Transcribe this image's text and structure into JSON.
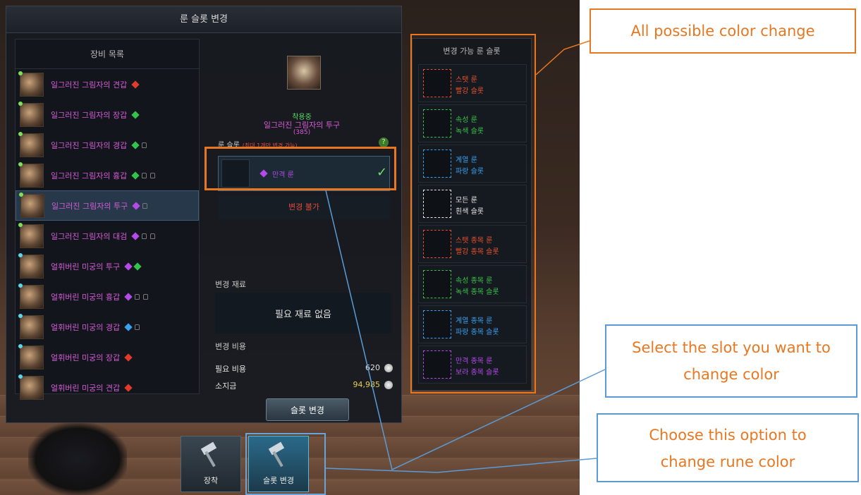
{
  "dialog": {
    "title": "룬 슬롯 변경"
  },
  "equipment": {
    "header": "장비 목록",
    "items": [
      {
        "name": "일그러진 그림자의 견갑",
        "gems": [
          "red"
        ],
        "locks": 0,
        "dot": "green"
      },
      {
        "name": "일그러진 그림자의 장갑",
        "gems": [
          "green"
        ],
        "locks": 0,
        "dot": "green"
      },
      {
        "name": "일그러진 그림자의 경갑",
        "gems": [
          "green"
        ],
        "locks": 1,
        "dot": "green"
      },
      {
        "name": "일그러진 그림자의 흉갑",
        "gems": [
          "green"
        ],
        "locks": 2,
        "dot": "green"
      },
      {
        "name": "일그러진 그림자의 투구",
        "gems": [
          "purple"
        ],
        "locks": 1,
        "dot": "green",
        "selected": true
      },
      {
        "name": "일그러진 그림자의 대검",
        "gems": [
          "purple"
        ],
        "locks": 2,
        "dot": "green"
      },
      {
        "name": "얼휘버린 미궁의 투구",
        "gems": [
          "purple",
          "green"
        ],
        "locks": 0,
        "dot": "cyan"
      },
      {
        "name": "얼휘버린 미궁의 흉갑",
        "gems": [
          "purple"
        ],
        "locks": 2,
        "dot": "cyan"
      },
      {
        "name": "얼휘버린 미궁의 경갑",
        "gems": [
          "blue"
        ],
        "locks": 1,
        "dot": "cyan"
      },
      {
        "name": "얼휘버린 미궁의 장갑",
        "gems": [
          "red"
        ],
        "locks": 0,
        "dot": "cyan"
      },
      {
        "name": "얼휘버린 미궁의 견갑",
        "gems": [
          "red"
        ],
        "locks": 0,
        "dot": "cyan"
      }
    ]
  },
  "detail": {
    "equipped_label": "착용중",
    "item_name": "일그러진 그림자의 투구",
    "item_count": "(385)",
    "slot_label": "룬 슬롯",
    "slot_note": "(최대 1개만 변경 가능)",
    "help": "?",
    "current_rune": "만격 룬",
    "no_change": "변경 불가",
    "materials_label": "변경 재료",
    "materials_none": "필요 재료 없음",
    "cost_label": "변경 비용",
    "required_cost_label": "필요 비용",
    "required_cost": "620",
    "owned_label": "소지금",
    "owned": "94,985",
    "change_button": "슬롯 변경"
  },
  "rune_slots": {
    "header": "변경 가능 룬 슬롯",
    "items": [
      {
        "line1": "스탯 룬",
        "line2": "빨강 슬롯",
        "color": "#e8502e"
      },
      {
        "line1": "속성 룬",
        "line2": "녹색 슬롯",
        "color": "#3cc24a"
      },
      {
        "line1": "계열 룬",
        "line2": "파랑 슬롯",
        "color": "#3aa0f0"
      },
      {
        "line1": "모든 룬",
        "line2": "흰색 슬롯",
        "color": "#e8e8e8"
      },
      {
        "line1": "스탯 종목 룬",
        "line2": "빨강 종목 슬롯",
        "color": "#e8502e"
      },
      {
        "line1": "속성 종목 룬",
        "line2": "녹색 종목 슬롯",
        "color": "#3cc24a"
      },
      {
        "line1": "계열 종목 룬",
        "line2": "파랑 종목 슬롯",
        "color": "#3aa0f0"
      },
      {
        "line1": "만격 종목 룬",
        "line2": "보라 종목 슬롯",
        "color": "#b44ae8"
      }
    ]
  },
  "bottom_buttons": {
    "equip": "장착",
    "slot_change": "슬롯 변경"
  },
  "callouts": {
    "all_colors": "All possible color change",
    "select_slot_1": "Select the slot you want to",
    "select_slot_2": "change color",
    "choose_option_1": "Choose this option to",
    "choose_option_2": "change rune color"
  }
}
